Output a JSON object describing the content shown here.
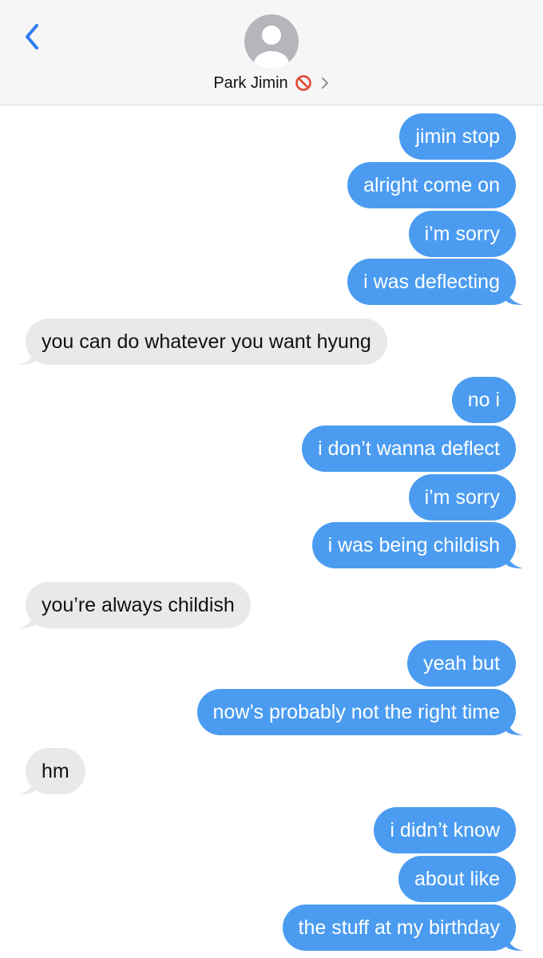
{
  "header": {
    "back_icon": "chevron-left-icon",
    "avatar_icon": "person-silhouette-icon",
    "contact_name": "Park Jimin",
    "blocked_icon": "no-entry-icon",
    "detail_icon": "chevron-right-icon"
  },
  "colors": {
    "sent_bubble": "#4b9cf0",
    "received_bubble": "#e9e9eb",
    "back_chevron": "#2f7bf5",
    "blocked_icon": "#e0462f"
  },
  "messages": [
    {
      "from": "me",
      "text": "jimin stop"
    },
    {
      "from": "me",
      "text": "alright come on"
    },
    {
      "from": "me",
      "text": "i’m sorry"
    },
    {
      "from": "me",
      "text": "i was deflecting"
    },
    {
      "from": "them",
      "text": "you can do whatever you want hyung"
    },
    {
      "from": "me",
      "text": "no i"
    },
    {
      "from": "me",
      "text": "i don’t wanna deflect"
    },
    {
      "from": "me",
      "text": "i’m sorry"
    },
    {
      "from": "me",
      "text": "i was being childish"
    },
    {
      "from": "them",
      "text": "you’re always childish"
    },
    {
      "from": "me",
      "text": "yeah but"
    },
    {
      "from": "me",
      "text": "now’s probably not the right time"
    },
    {
      "from": "them",
      "text": "hm"
    },
    {
      "from": "me",
      "text": "i didn’t know"
    },
    {
      "from": "me",
      "text": "about like"
    },
    {
      "from": "me",
      "text": "the stuff at my birthday"
    }
  ]
}
